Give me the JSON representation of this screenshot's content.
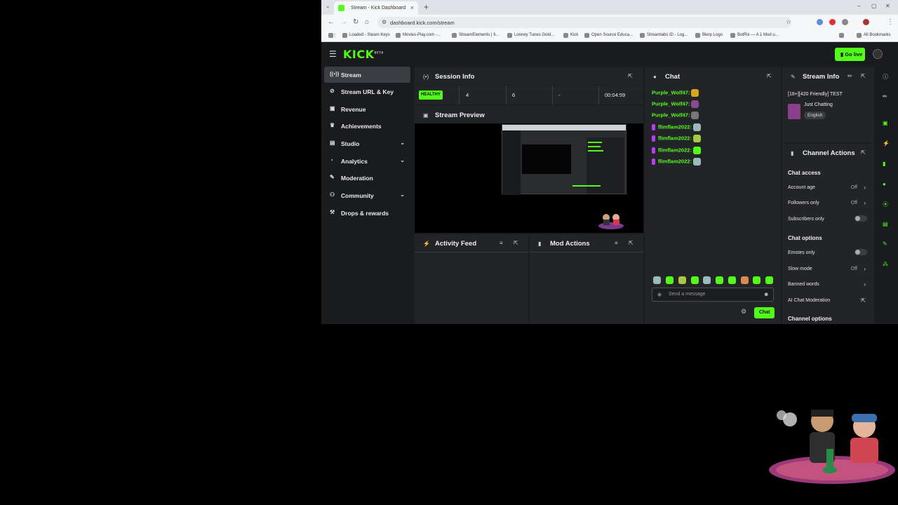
{
  "browser": {
    "tab_title": "Stream - Kick Dashboard",
    "url": "dashboard.kick.com/stream",
    "bookmarks": [
      "Loaded - Steam Keys",
      "Movies-Play.com -...",
      "StreamElements | Il...",
      "Looney Tunes Gold...",
      "Kick",
      "Open Source Educa...",
      "Streamlabs ID - Log...",
      "Blerp Logo",
      "BotRix — A 1 Mod u..."
    ],
    "all_bookmarks": "All Bookmarks"
  },
  "header": {
    "logo": "KICK",
    "logo_sup": "BETA",
    "go_live": "Go live"
  },
  "sidebar": {
    "items": [
      {
        "label": "Stream",
        "icon": "broadcast-icon"
      },
      {
        "label": "Stream URL & Key",
        "icon": "link-icon"
      },
      {
        "label": "Revenue",
        "icon": "revenue-icon"
      },
      {
        "label": "Achievements",
        "icon": "trophy-icon"
      },
      {
        "label": "Studio",
        "icon": "studio-icon"
      },
      {
        "label": "Analytics",
        "icon": "analytics-icon"
      },
      {
        "label": "Moderation",
        "icon": "wrench-icon"
      },
      {
        "label": "Community",
        "icon": "community-icon"
      },
      {
        "label": "Drops & rewards",
        "icon": "gift-icon"
      }
    ]
  },
  "session": {
    "title": "Session Info",
    "status": "HEALTHY",
    "stat1": "4",
    "stat2": "6",
    "stat3": "-",
    "duration": "00:04:59"
  },
  "preview": {
    "title": "Stream Preview"
  },
  "activity": {
    "title": "Activity Feed"
  },
  "mod_actions": {
    "title": "Mod Actions"
  },
  "chat": {
    "title": "Chat",
    "messages": [
      {
        "user": "Purple_Wolf47:"
      },
      {
        "user": "Purple_Wolf47:"
      },
      {
        "user": "Purple_Wolf47:"
      },
      {
        "user": "flimflam2022:"
      },
      {
        "user": "flimflam2022:"
      },
      {
        "user": "flimflam2022:"
      },
      {
        "user": "flimflam2022:"
      }
    ],
    "placeholder": "Send a message",
    "send_label": "Chat"
  },
  "stream_info": {
    "title": "Stream Info",
    "stream_title": "[18+][420 Friendly] TEST",
    "category": "Just Chatting",
    "language": "English"
  },
  "channel_actions": {
    "title": "Channel Actions",
    "chat_access": "Chat access",
    "account_age": {
      "label": "Account age",
      "value": "Off"
    },
    "followers_only": {
      "label": "Followers only",
      "value": "Off"
    },
    "subscribers_only": {
      "label": "Subscribers only",
      "enabled": false
    },
    "chat_options": "Chat options",
    "emotes_only": {
      "label": "Emotes only",
      "enabled": false
    },
    "slow_mode": {
      "label": "Slow mode",
      "value": "Off"
    },
    "banned_words": "Banned words",
    "ai_moderation": "AI Chat Moderation",
    "channel_options": "Channel options"
  },
  "colors": {
    "accent": "#53fc18",
    "panel": "#232428",
    "bg": "#191b1f"
  }
}
